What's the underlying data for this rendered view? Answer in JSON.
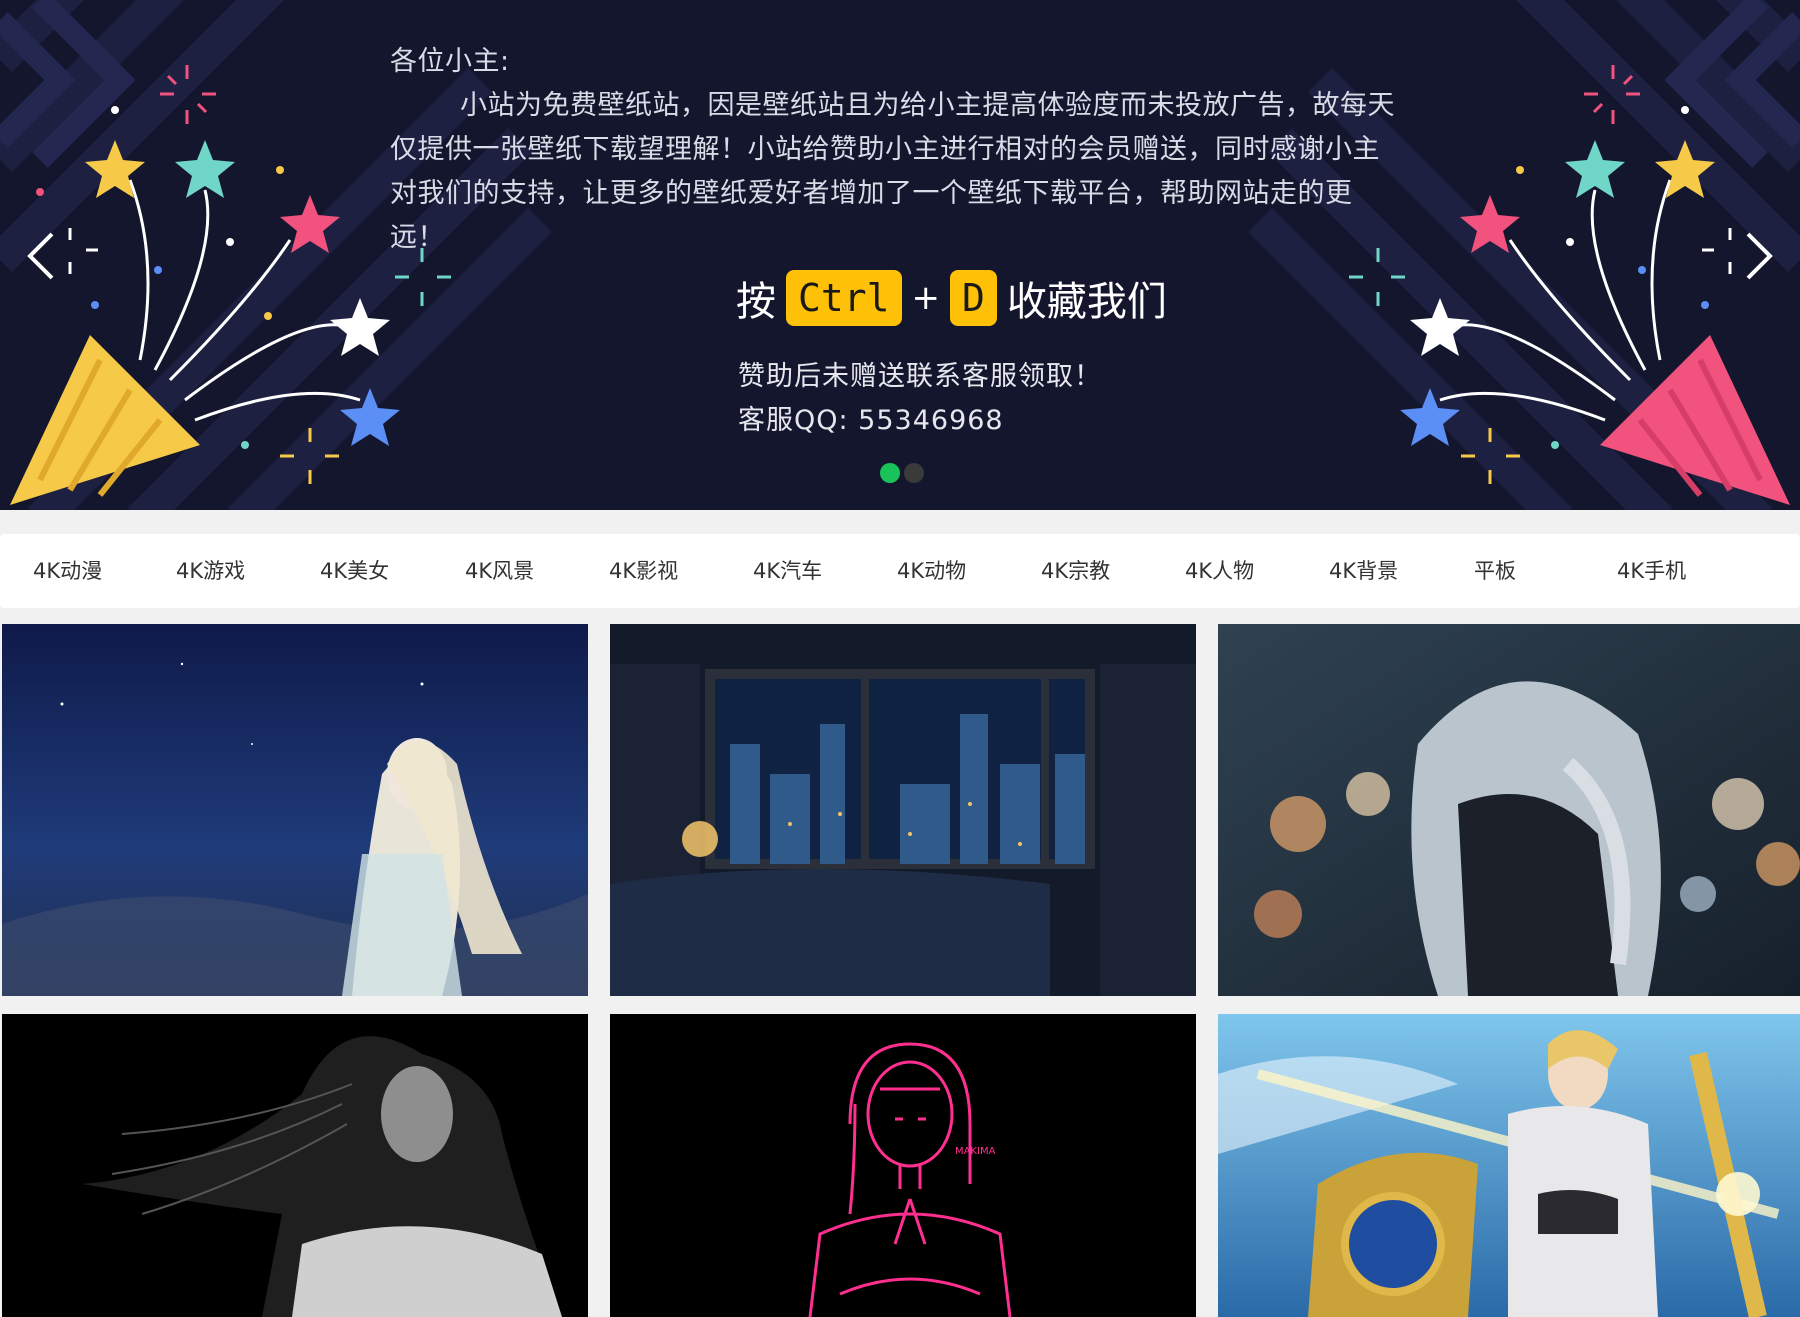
{
  "banner": {
    "greeting": "各位小主:",
    "body": "小站为免费壁纸站，因是壁纸站且为给小主提高体验度而未投放广告，故每天仅提供一张壁纸下载望理解！小站给赞助小主进行相对的会员赠送，同时感谢小主对我们的支持，让更多的壁纸爱好者增加了一个壁纸下载平台，帮助网站走的更远！",
    "shortcut_prefix": "按",
    "key1": "Ctrl",
    "plus": "+",
    "key2": "D",
    "shortcut_suffix": "收藏我们",
    "contact_line1": "赞助后未赠送联系客服领取！",
    "contact_line2": "客服QQ: 55346968",
    "slides_total": 2,
    "slide_active": 1,
    "colors": {
      "bg": "#14162e",
      "dot_active": "#19c35a",
      "key": "#ffc107"
    }
  },
  "categories": [
    "4K动漫",
    "4K游戏",
    "4K美女",
    "4K风景",
    "4K影视",
    "4K汽车",
    "4K动物",
    "4K宗教",
    "4K人物",
    "4K背景",
    "平板",
    "4K手机"
  ],
  "thumbnails": [
    {
      "subject": "anime-girl-starry-night"
    },
    {
      "subject": "bedroom-rainy-city-night"
    },
    {
      "subject": "girl-braid-bokeh"
    },
    {
      "subject": "dark-hair-woman-black-bg"
    },
    {
      "subject": "neon-pink-girl-makima"
    },
    {
      "subject": "golden-armored-knight-sword"
    }
  ],
  "thumb_labels": {
    "neon": "MAKIMA"
  }
}
